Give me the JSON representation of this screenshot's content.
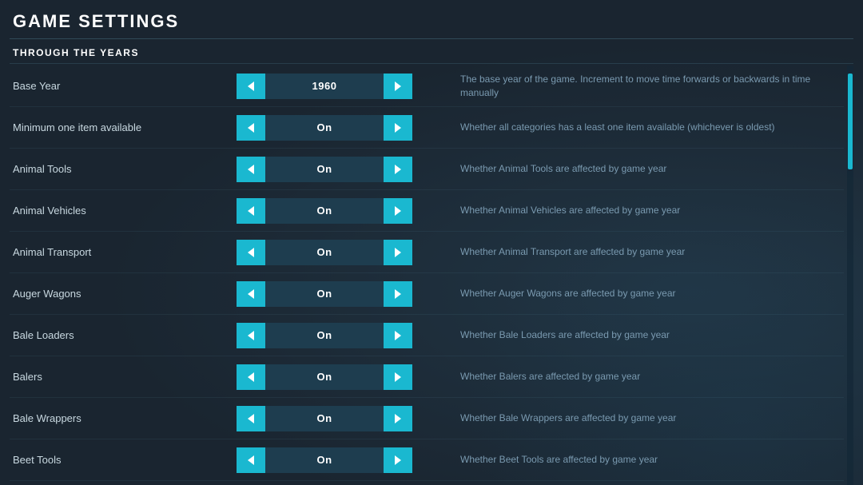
{
  "page": {
    "title": "GAME SETTINGS",
    "section": "THROUGH THE YEARS"
  },
  "settings": [
    {
      "label": "Base Year",
      "value": "1960",
      "description": "The base year of the game. Increment to move time forwards or backwards in time manually"
    },
    {
      "label": "Minimum one item available",
      "value": "On",
      "description": "Whether all categories has a least one item available (whichever is oldest)"
    },
    {
      "label": "Animal Tools",
      "value": "On",
      "description": "Whether Animal Tools are affected by game year"
    },
    {
      "label": "Animal Vehicles",
      "value": "On",
      "description": "Whether Animal Vehicles are affected by game year"
    },
    {
      "label": "Animal Transport",
      "value": "On",
      "description": "Whether Animal Transport are affected by game year"
    },
    {
      "label": "Auger Wagons",
      "value": "On",
      "description": "Whether Auger Wagons are affected by game year"
    },
    {
      "label": "Bale Loaders",
      "value": "On",
      "description": "Whether Bale Loaders are affected by game year"
    },
    {
      "label": "Balers",
      "value": "On",
      "description": "Whether Balers are affected by game year"
    },
    {
      "label": "Bale Wrappers",
      "value": "On",
      "description": "Whether Bale Wrappers are affected by game year"
    },
    {
      "label": "Beet Tools",
      "value": "On",
      "description": "Whether Beet Tools are affected by game year"
    }
  ],
  "scrollbar": {
    "visible": true
  }
}
